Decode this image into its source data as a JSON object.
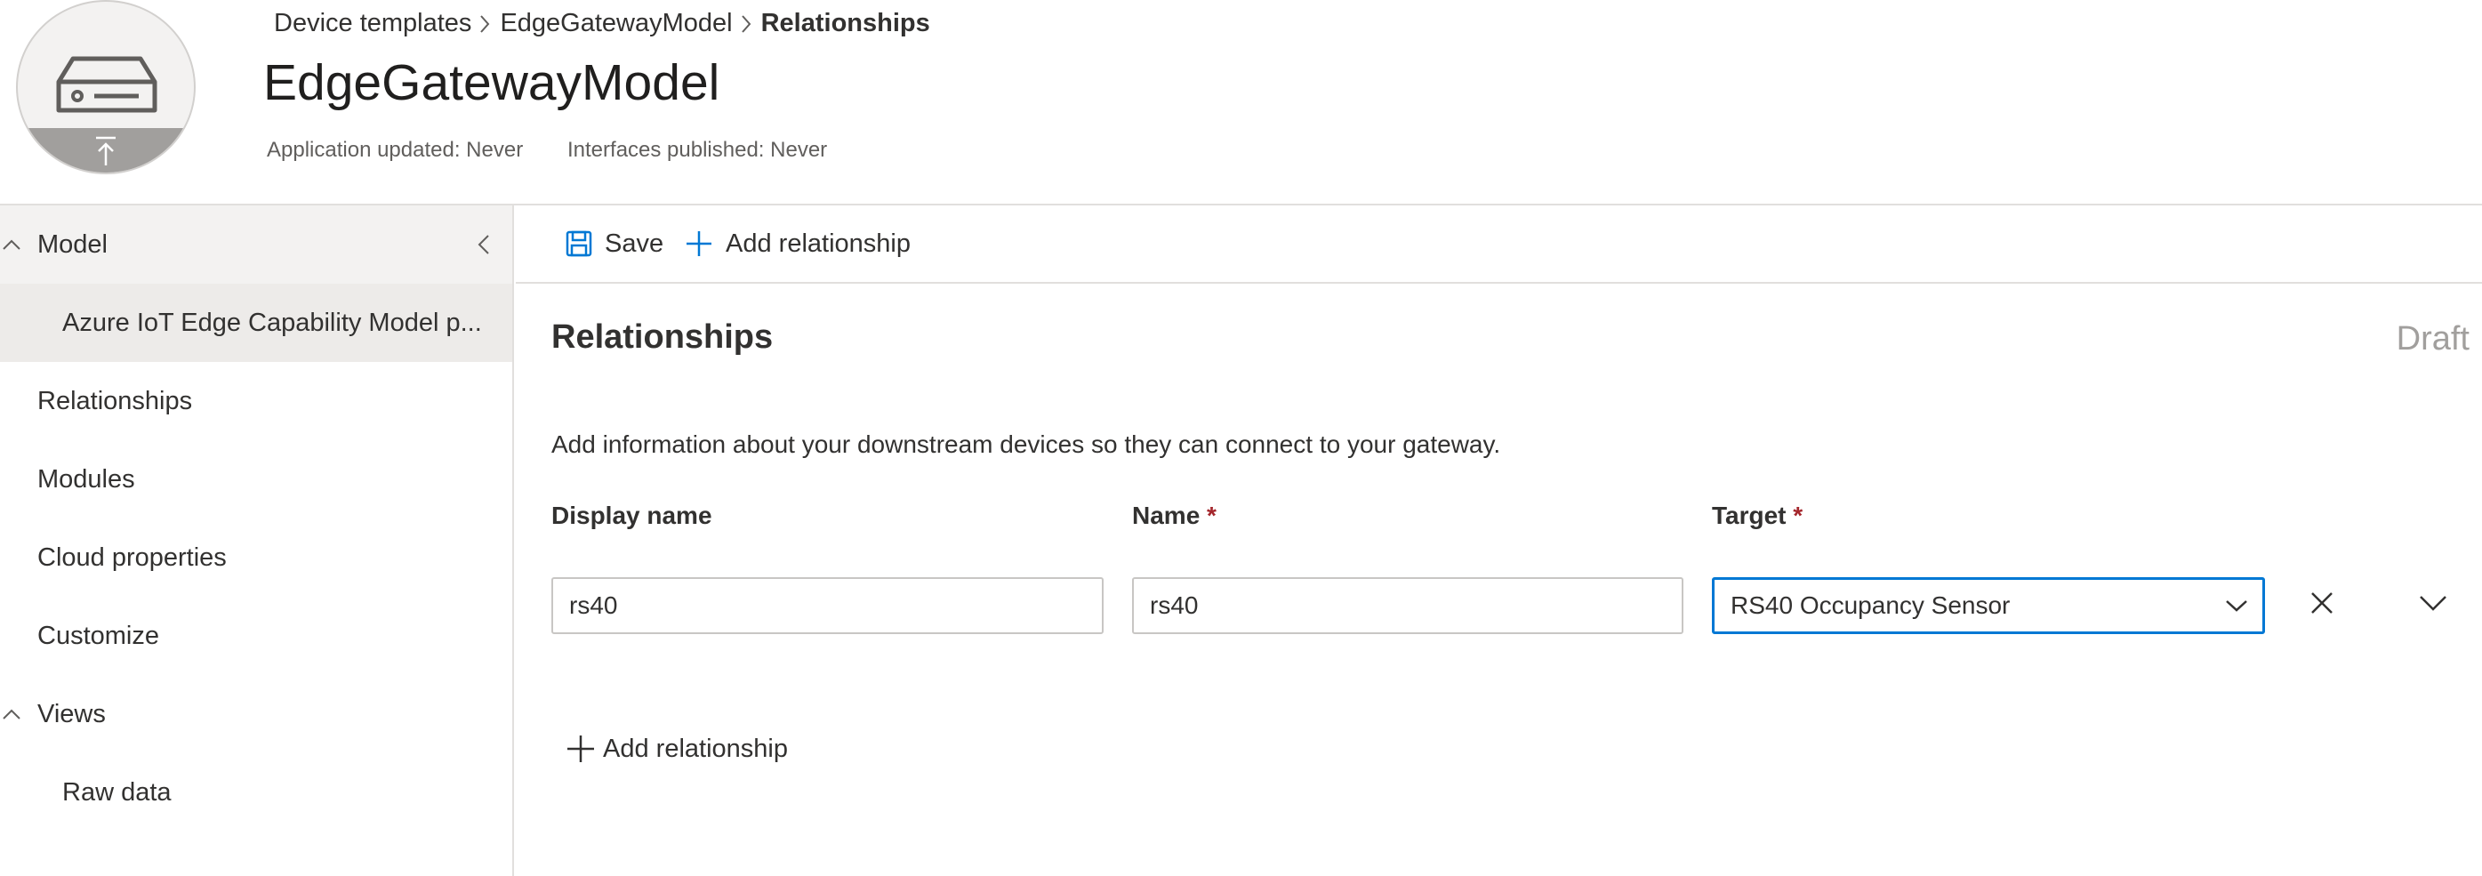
{
  "breadcrumb": {
    "items": [
      "Device templates",
      "EdgeGatewayModel"
    ],
    "current": "Relationships"
  },
  "header": {
    "title": "EdgeGatewayModel",
    "application_updated": "Application updated: Never",
    "interfaces_published": "Interfaces published: Never"
  },
  "sidebar": {
    "model_group": "Model",
    "capability_model": "Azure IoT Edge Capability Model p...",
    "relationships": "Relationships",
    "modules": "Modules",
    "cloud_properties": "Cloud properties",
    "customize": "Customize",
    "views_group": "Views",
    "raw_data": "Raw data"
  },
  "toolbar": {
    "save_label": "Save",
    "add_relationship_label": "Add relationship"
  },
  "main": {
    "section_title": "Relationships",
    "status": "Draft",
    "description": "Add information about your downstream devices so they can connect to your gateway.",
    "columns": {
      "display_name": "Display name",
      "name": "Name",
      "target": "Target",
      "required_marker": "*"
    },
    "row": {
      "display_name_value": "rs40",
      "name_value": "rs40",
      "target_value": "RS40 Occupancy Sensor"
    },
    "add_relationship_label": "Add relationship"
  },
  "icons": {
    "device": "device-icon",
    "upload": "upload-icon",
    "save": "save-icon",
    "add": "plus-icon",
    "delete": "close-icon",
    "expand": "chevron-down-icon",
    "collapse_group": "chevron-up-icon",
    "collapse_pane": "chevron-left-icon"
  },
  "colors": {
    "accent": "#0078d4",
    "required": "#a4262c",
    "status": "#a19f9d"
  }
}
